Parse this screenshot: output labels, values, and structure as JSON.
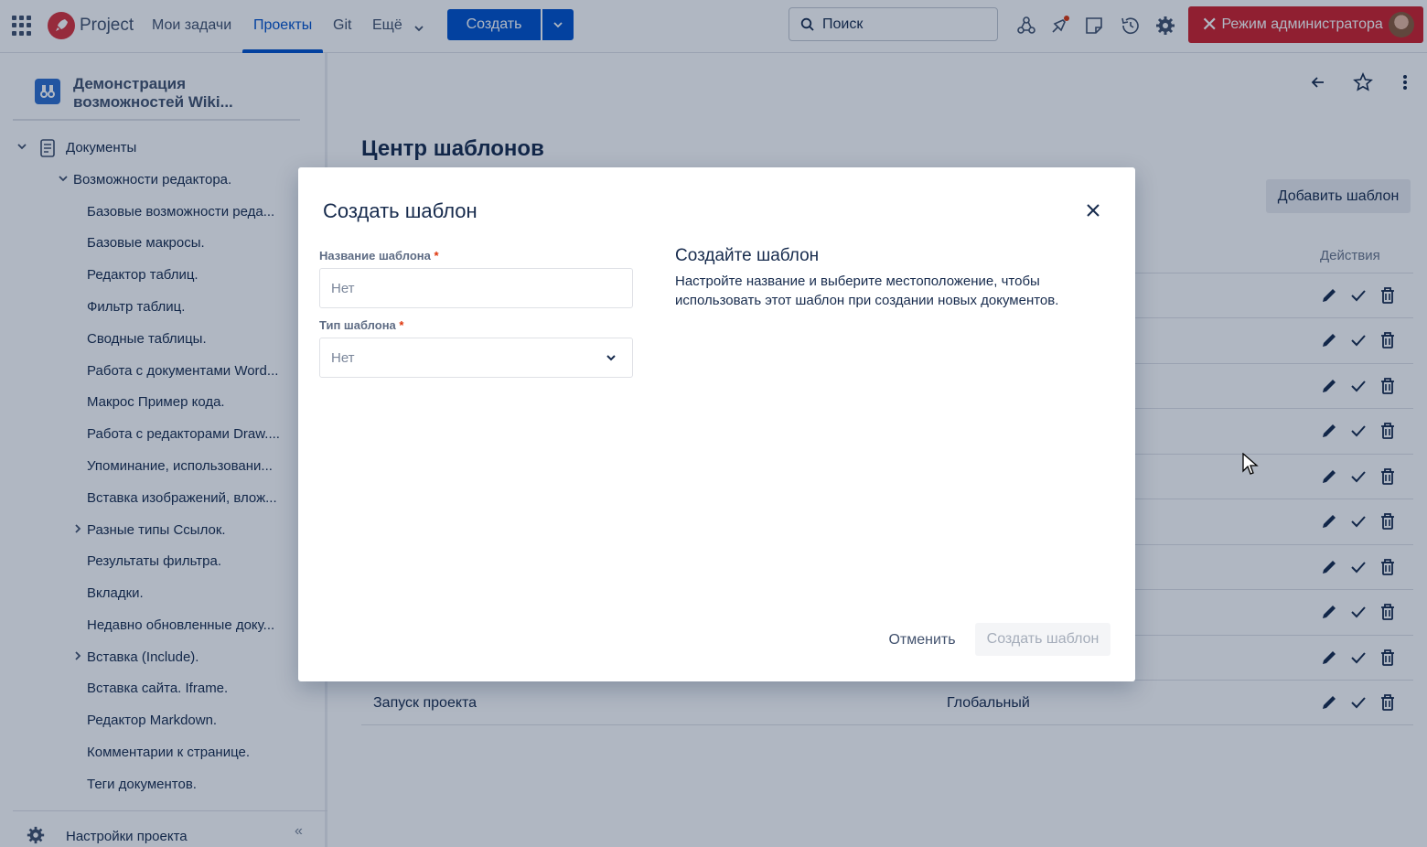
{
  "topbar": {
    "brand": "Project",
    "nav": [
      "Мои задачи",
      "Проекты",
      "Git",
      "Ещё"
    ],
    "active_nav": "Проекты",
    "create_label": "Создать",
    "search_placeholder": "Поиск",
    "admin_label": "Режим администратора",
    "accent_color": "#0052cc",
    "admin_color": "#d0202a"
  },
  "sidebar": {
    "space_name": "Демонстрация возможностей Wiki...",
    "root": "Документы",
    "section": "Возможности редактора.",
    "items": [
      "Базовые возможности реда...",
      "Базовые макросы.",
      "Редактор таблиц.",
      "Фильтр таблиц.",
      "Сводные таблицы.",
      "Работа с документами Word...",
      "Макрос Пример кода.",
      "Работа с редакторами Draw....",
      "Упоминание, использовани...",
      "Вставка изображений, влож...",
      "Разные типы Ссылок.",
      "Результаты фильтра.",
      "Вкладки.",
      "Недавно обновленные доку...",
      "Вставка (Include).",
      "Вставка сайта. Iframe.",
      "Редактор Markdown.",
      "Комментарии к странице.",
      "Теги документов."
    ],
    "settings_label": "Настройки проекта"
  },
  "main": {
    "title": "Центр шаблонов",
    "add_template_label": "Добавить шаблон",
    "col_actions": "Действия",
    "last_row": {
      "name": "Запуск проекта",
      "scope": "Глобальный"
    }
  },
  "modal": {
    "title": "Создать шаблон",
    "name_label": "Название шаблона",
    "name_placeholder": "Нет",
    "type_label": "Тип шаблона",
    "type_value": "Нет",
    "required_mark": "*",
    "info_title": "Создайте шаблон",
    "info_text": "Настройте название и выберите местоположение, чтобы использовать этот шаблон при создании новых документов.",
    "cancel_label": "Отменить",
    "submit_label": "Создать шаблон"
  }
}
